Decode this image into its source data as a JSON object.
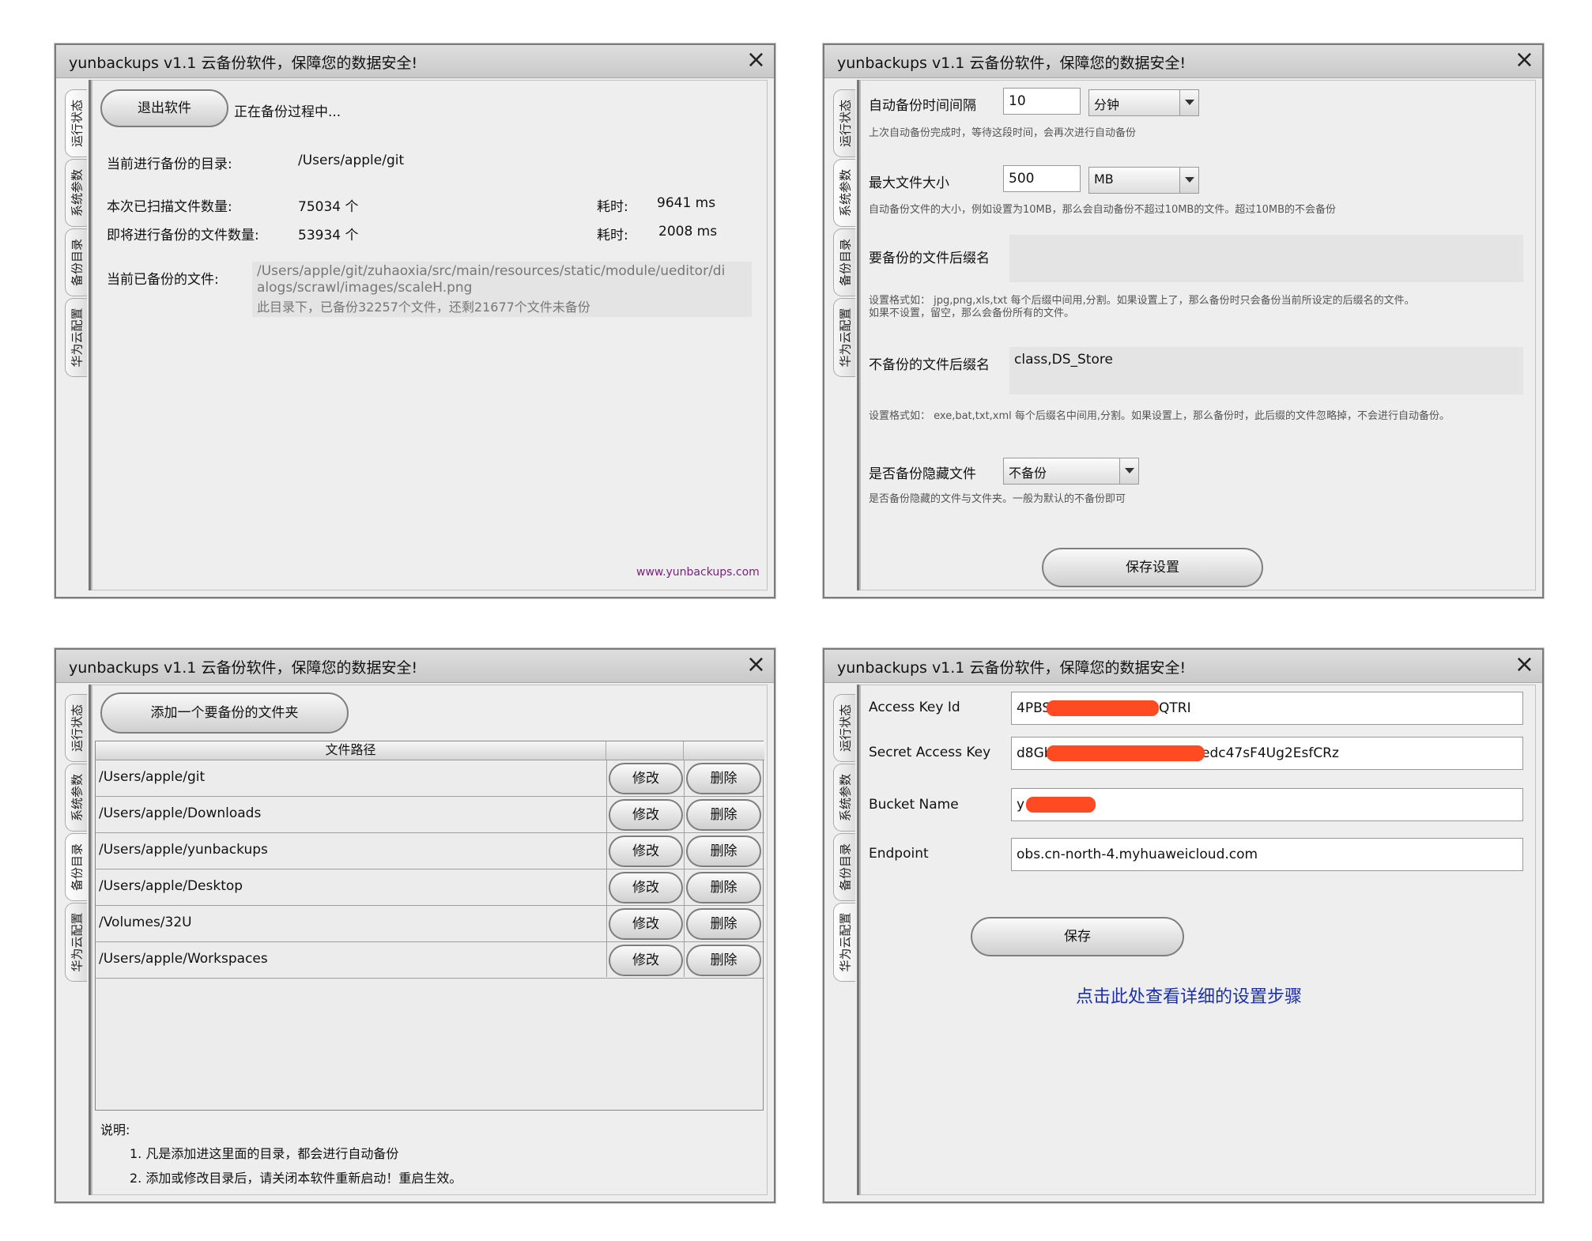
{
  "window_title": "yunbackups v1.1   云备份软件，保障您的数据安全!",
  "close_glyph": "×",
  "tabs": [
    "运行状态",
    "系统参数",
    "备份目录",
    "华为云配置"
  ],
  "status_panel": {
    "exit_button": "退出软件",
    "state_text": "正在备份过程中...",
    "current_dir_label": "当前进行备份的目录:",
    "current_dir_value": "/Users/apple/git",
    "scanned_label": "本次已扫描文件数量:",
    "scanned_value": "75034 个",
    "scanned_time_label": "耗时:",
    "scanned_time_value": "9641 ms",
    "pending_label": "即将进行备份的文件数量:",
    "pending_value": "53934 个",
    "pending_time_label": "耗时:",
    "pending_time_value": "2008 ms",
    "current_file_label": "当前已备份的文件:",
    "current_file_line1": "/Users/apple/git/zuhaoxia/src/main/resources/static/module/ueditor/di",
    "current_file_line2": "alogs/scrawl/images/scaleH.png",
    "current_file_line3": "此目录下，已备份32257个文件，还剩21677个文件未备份",
    "site_link": "www.yunbackups.com"
  },
  "params_panel": {
    "interval_label": "自动备份时间间隔",
    "interval_value": "10",
    "interval_unit": "分钟",
    "interval_hint": "上次自动备份完成时，等待这段时间，会再次进行自动备份",
    "maxsize_label": "最大文件大小",
    "maxsize_value": "500",
    "maxsize_unit": "MB",
    "maxsize_hint": "自动备份文件的大小，例如设置为10MB，那么会自动备份不超过10MB的文件。超过10MB的不会备份",
    "include_label": "要备份的文件后缀名",
    "include_value": "",
    "include_hint1": "设置格式如：  jpg,png,xls,txt 每个后缀中间用,分割。如果设置上了，那么备份时只会备份当前所设定的后缀名的文件。",
    "include_hint2": "如果不设置，留空，那么会备份所有的文件。",
    "exclude_label": "不备份的文件后缀名",
    "exclude_value": "class,DS_Store",
    "exclude_hint": "设置格式如：  exe,bat,txt,xml 每个后缀名中间用,分割。如果设置上，那么备份时，此后缀的文件忽略掉，不会进行自动备份。",
    "hidden_label": "是否备份隐藏文件",
    "hidden_value": "不备份",
    "hidden_hint": "是否备份隐藏的文件与文件夹。一般为默认的不备份即可",
    "save_button": "保存设置"
  },
  "dirs_panel": {
    "add_button": "添加一个要备份的文件夹",
    "col_path": "文件路径",
    "edit_label": "修改",
    "delete_label": "删除",
    "rows": [
      "/Users/apple/git",
      "/Users/apple/Downloads",
      "/Users/apple/yunbackups",
      "/Users/apple/Desktop",
      "/Volumes/32U",
      "/Users/apple/Workspaces"
    ],
    "note_title": "说明:",
    "note1": "1. 凡是添加进这里面的目录，都会进行自动备份",
    "note2": "2. 添加或修改目录后，请关闭本软件重新启动！重启生效。"
  },
  "cloud_panel": {
    "ak_label": "Access Key Id",
    "ak_prefix": "4PBS/",
    "ak_suffix": "QTRI",
    "sk_label": "Secret Access Key",
    "sk_prefix": "d8Gb",
    "sk_suffix": "edc47sF4Ug2EsfCRz",
    "bucket_label": "Bucket Name",
    "bucket_prefix": "y",
    "endpoint_label": "Endpoint",
    "endpoint_value": "obs.cn-north-4.myhuaweicloud.com",
    "save_button": "保存",
    "help_link": "点击此处查看详细的设置步骤"
  },
  "colors": {
    "link_purple": "#7a1f7a",
    "link_blue": "#1b2fa8",
    "redaction": "#ff4a22"
  }
}
